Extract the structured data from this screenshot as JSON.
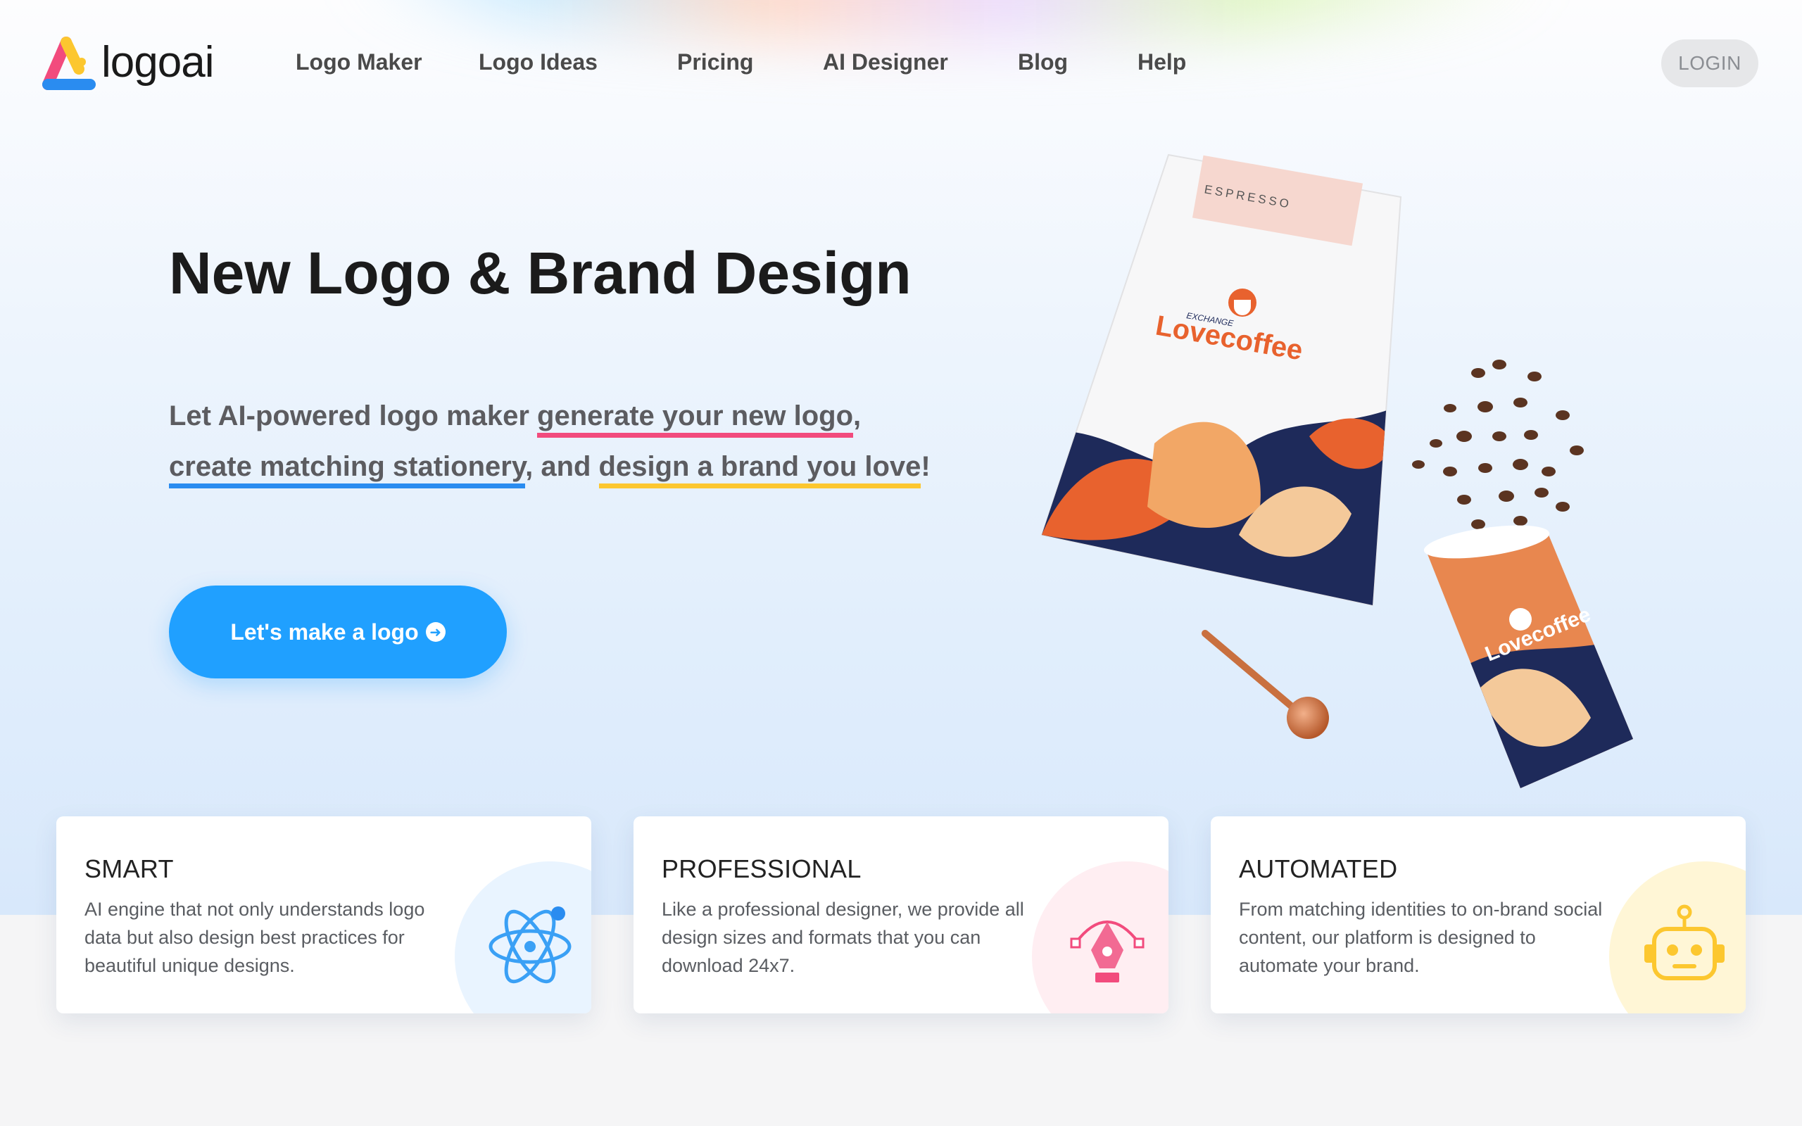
{
  "brand": {
    "name": "logoai",
    "colors": {
      "pink": "#f24b7d",
      "blue": "#2a8cf0",
      "yellow": "#fcc72f",
      "cta": "#20a0ff"
    }
  },
  "nav": {
    "items": [
      "Logo Maker",
      "Logo Ideas",
      "Pricing",
      "AI Designer",
      "Blog",
      "Help"
    ],
    "login": "LOGIN"
  },
  "hero": {
    "headline": "New Logo & Brand Design",
    "sub_1": "Let AI-powered logo maker ",
    "sub_link_1": "generate your new logo",
    "sub_2": ",",
    "sub_link_2": "create matching stationery",
    "sub_3": ", and ",
    "sub_link_3": "design a brand you love",
    "sub_4": "!",
    "cta_label": "Let's make a logo",
    "cta_icon": "arrow-circle-right-icon"
  },
  "illustration": {
    "bag_label": "ESPRESSO",
    "bag_brand_top": "EXCHANGE",
    "bag_brand": "Lovecoffee",
    "cup_brand": "Lovecoffee"
  },
  "features": [
    {
      "title": "SMART",
      "desc": "AI engine that not only understands logo data but also design best practices for beautiful unique designs.",
      "icon": "atom-icon",
      "color": "#e9f4ff"
    },
    {
      "title": "PROFESSIONAL",
      "desc": "Like a professional designer, we provide all design sizes and formats that you can download 24x7.",
      "icon": "pen-tool-icon",
      "color": "#ffeef2"
    },
    {
      "title": "AUTOMATED",
      "desc": "From matching identities to on-brand social content, our platform is designed to automate your brand.",
      "icon": "robot-icon",
      "color": "#fff6d6"
    }
  ]
}
